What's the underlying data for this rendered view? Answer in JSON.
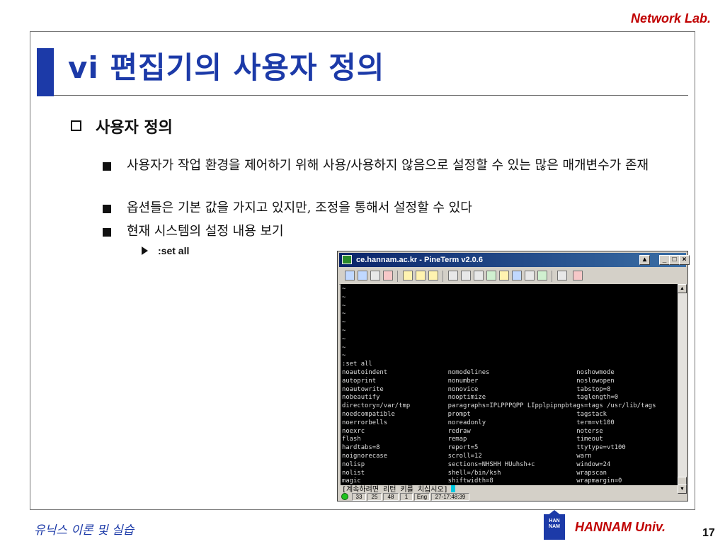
{
  "header": {
    "brand": "Network Lab."
  },
  "slide": {
    "title": "vi 편집기의 사용자 정의",
    "heading": "사용자 정의",
    "bullets": [
      "사용자가 작업 환경을 제어하기 위해 사용/사용하지 않음으로 설정할 수 있는 많은 매개변수가 존재",
      "옵션들은 기본 값을 가지고 있지만, 조정을 통해서 설정할 수 있다",
      "현재 시스템의 설정 내용 보기"
    ],
    "sub_bullet": ":set all"
  },
  "terminal": {
    "title": "ce.hannam.ac.kr - PineTerm v2.0.6",
    "output": "~\n~\n~\n~\n~\n~\n~\n~\n~\n:set all\nnoautoindent                nomodelines                       noshowmode\nautoprint                   nonumber                          noslowopen\nnoautowrite                 nonovice                          tabstop=8\nnobeautify                  nooptimize                        taglength=0\ndirectory=/var/tmp          paragraphs=IPLPPPQPP LIpplpipnpbtags=tags /usr/lib/tags\nnoedcompatible              prompt                            tagstack\nnoerrorbells                noreadonly                        term=vt100\nnoexrc                      redraw                            noterse\nflash                       remap                             timeout\nhardtabs=8                  report=5                          ttytype=vt100\nnoignorecase                scroll=12                         warn\nnolisp                      sections=NHSHH HUuhsh+c           window=24\nnolist                      shell=/bin/ksh                    wrapscan\nmagic                       shiftwidth=8                      wrapmargin=0\nmesg                        noshowmatch                       nowriteany",
    "prompt": "[계속하려면 리턴 키를 치십시오]",
    "status": [
      "33",
      "25",
      "48",
      "1",
      "Eng",
      "27-17:48:39"
    ]
  },
  "footer": {
    "course": "유닉스 이론 및 실습",
    "logo_text": "HAN NAM",
    "university": "HANNAM Univ.",
    "page": "17"
  }
}
